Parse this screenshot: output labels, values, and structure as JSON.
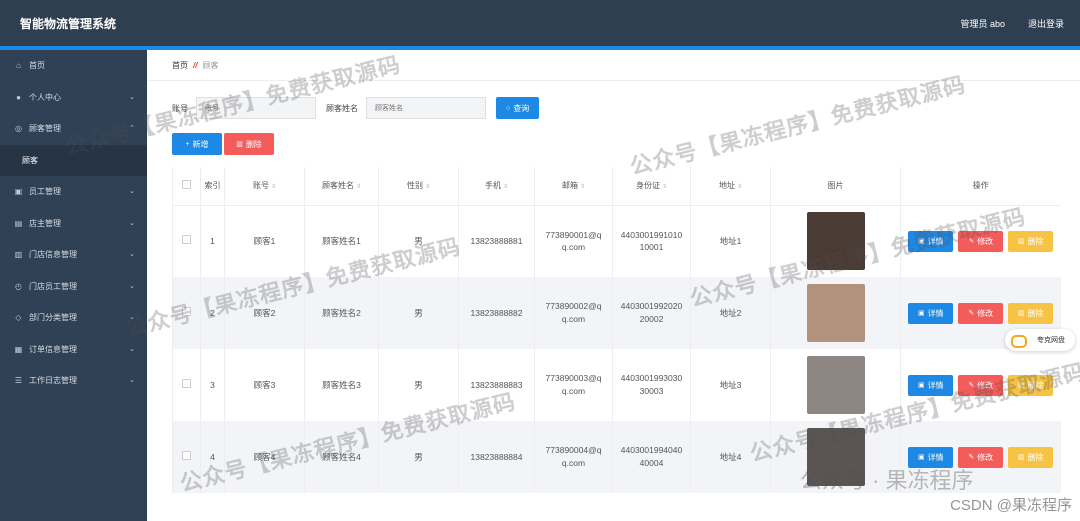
{
  "app": {
    "title": "智能物流管理系统",
    "admin": "管理员 abo",
    "logout": "退出登录"
  },
  "sidebar": {
    "items": [
      {
        "label": "首页",
        "icon": "home-icon",
        "chev": ""
      },
      {
        "label": "个人中心",
        "icon": "user-icon",
        "chev": "⌄"
      },
      {
        "label": "顾客管理",
        "icon": "customer-icon",
        "chev": "⌃"
      },
      {
        "label": "顾客",
        "sub": true
      },
      {
        "label": "员工管理",
        "icon": "staff-icon",
        "chev": "⌄"
      },
      {
        "label": "店主管理",
        "icon": "owner-icon",
        "chev": "⌄"
      },
      {
        "label": "门店信息管理",
        "icon": "store-icon",
        "chev": "⌄"
      },
      {
        "label": "门店员工管理",
        "icon": "store-staff-icon",
        "chev": "⌄"
      },
      {
        "label": "部门分类管理",
        "icon": "dept-icon",
        "chev": "⌄"
      },
      {
        "label": "订单信息管理",
        "icon": "order-icon",
        "chev": "⌄"
      },
      {
        "label": "工作日志管理",
        "icon": "log-icon",
        "chev": "⌄"
      }
    ]
  },
  "breadcrumb": {
    "home": "首页",
    "sep": "//",
    "current": "顾客"
  },
  "search": {
    "account_label": "账号",
    "account_placeholder": "账号",
    "name_label": "顾客姓名",
    "name_placeholder": "顾客姓名",
    "query_button": "查询"
  },
  "actions": {
    "add": "新增",
    "delete": "删除"
  },
  "table": {
    "headers": {
      "index": "索引",
      "account": "账号",
      "name": "顾客姓名",
      "gender": "性别",
      "phone": "手机",
      "email": "邮箱",
      "idcard": "身份证",
      "address": "地址",
      "photo": "图片",
      "ops": "操作"
    },
    "rows": [
      {
        "index": "1",
        "account": "顾客1",
        "name": "顾客姓名1",
        "gender": "男",
        "phone": "13823888881",
        "email_a": "773890001@q",
        "email_b": "q.com",
        "id_a": "4403001991010",
        "id_b": "10001",
        "address": "地址1",
        "photo_color": "#4a3b34"
      },
      {
        "index": "2",
        "account": "顾客2",
        "name": "顾客姓名2",
        "gender": "男",
        "phone": "13823888882",
        "email_a": "773890002@q",
        "email_b": "q.com",
        "id_a": "4403001992020",
        "id_b": "20002",
        "address": "地址2",
        "photo_color": "#b3927d"
      },
      {
        "index": "3",
        "account": "顾客3",
        "name": "顾客姓名3",
        "gender": "男",
        "phone": "13823888883",
        "email_a": "773890003@q",
        "email_b": "q.com",
        "id_a": "4403001993030",
        "id_b": "30003",
        "address": "地址3",
        "photo_color": "#8d8682"
      },
      {
        "index": "4",
        "account": "顾客4",
        "name": "顾客姓名4",
        "gender": "男",
        "phone": "13823888884",
        "email_a": "773890004@q",
        "email_b": "q.com",
        "id_a": "4403001994040",
        "id_b": "40004",
        "address": "地址4",
        "photo_color": "#5a5553"
      }
    ],
    "row_buttons": {
      "detail": "详情",
      "edit": "修改",
      "delete": "删除"
    }
  },
  "overlay": {
    "watermark": "公众号【果冻程序】免费获取源码",
    "wechat_mark": "公众号 · 果冻程序",
    "csdn": "CSDN @果冻程序",
    "cloud_label": "夸克网盘"
  },
  "colors": {
    "topbar": "#2f3f52",
    "sidebar": "#304156",
    "accent": "#1e88e5",
    "danger": "#f45b5b",
    "warning": "#f6c343"
  }
}
